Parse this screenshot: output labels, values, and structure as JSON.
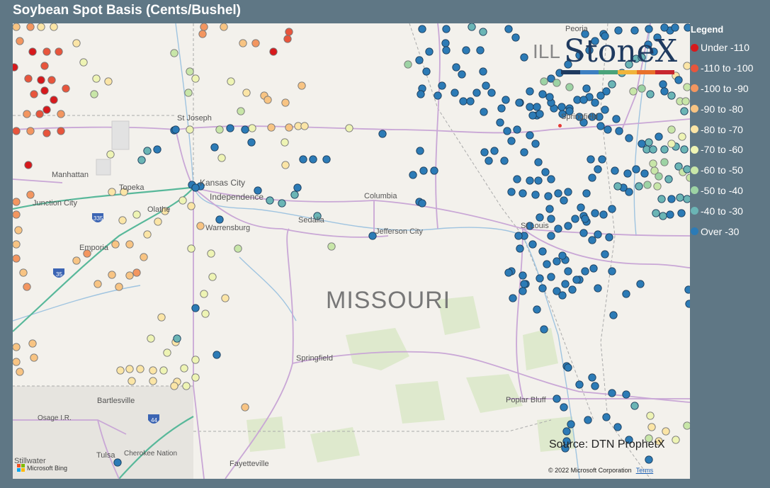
{
  "title": "Soybean Spot Basis (Cents/Bushel)",
  "legend": {
    "title": "Legend",
    "items": [
      {
        "label": "Under -110",
        "color": "#d7191c"
      },
      {
        "label": "-110 to -100",
        "color": "#e8553c"
      },
      {
        "label": "-100 to -90",
        "color": "#f39660"
      },
      {
        "label": "-90 to -80",
        "color": "#f8c483"
      },
      {
        "label": "-80 to -70",
        "color": "#fbe5a6"
      },
      {
        "label": "-70 to -60",
        "color": "#eef4b4"
      },
      {
        "label": "-60 to -50",
        "color": "#c8e6a8"
      },
      {
        "label": "-50 to -40",
        "color": "#9dd3a4"
      },
      {
        "label": "-40 to -30",
        "color": "#6bb5b5"
      },
      {
        "label": "Over -30",
        "color": "#2c7bb6"
      }
    ]
  },
  "map": {
    "state_label": "MISSOURI",
    "state_abbr_partial": "ILL",
    "cities": [
      {
        "name": "St Joseph"
      },
      {
        "name": "Manhattan"
      },
      {
        "name": "Topeka"
      },
      {
        "name": "Kansas City"
      },
      {
        "name": "Independence"
      },
      {
        "name": "Junction City"
      },
      {
        "name": "Olathe"
      },
      {
        "name": "Columbia"
      },
      {
        "name": "Warrensburg"
      },
      {
        "name": "Sedalia"
      },
      {
        "name": "Jefferson City"
      },
      {
        "name": "Emporia"
      },
      {
        "name": "St Louis"
      },
      {
        "name": "Springfield"
      },
      {
        "name": "Springfield"
      },
      {
        "name": "Bartlesville"
      },
      {
        "name": "Osage I.R."
      },
      {
        "name": "Poplar Bluff"
      },
      {
        "name": "Stillwater"
      },
      {
        "name": "Tulsa"
      },
      {
        "name": "Cherokee Nation"
      },
      {
        "name": "Fayetteville"
      },
      {
        "name": "Peoria"
      }
    ],
    "highway_shields": [
      "335",
      "35",
      "44"
    ],
    "source": "Source: DTN ProphetX",
    "copyright": "© 2022 Microsoft Corporation",
    "terms": "Terms",
    "bing": "Microsoft Bing",
    "brand": "StoneX"
  }
}
